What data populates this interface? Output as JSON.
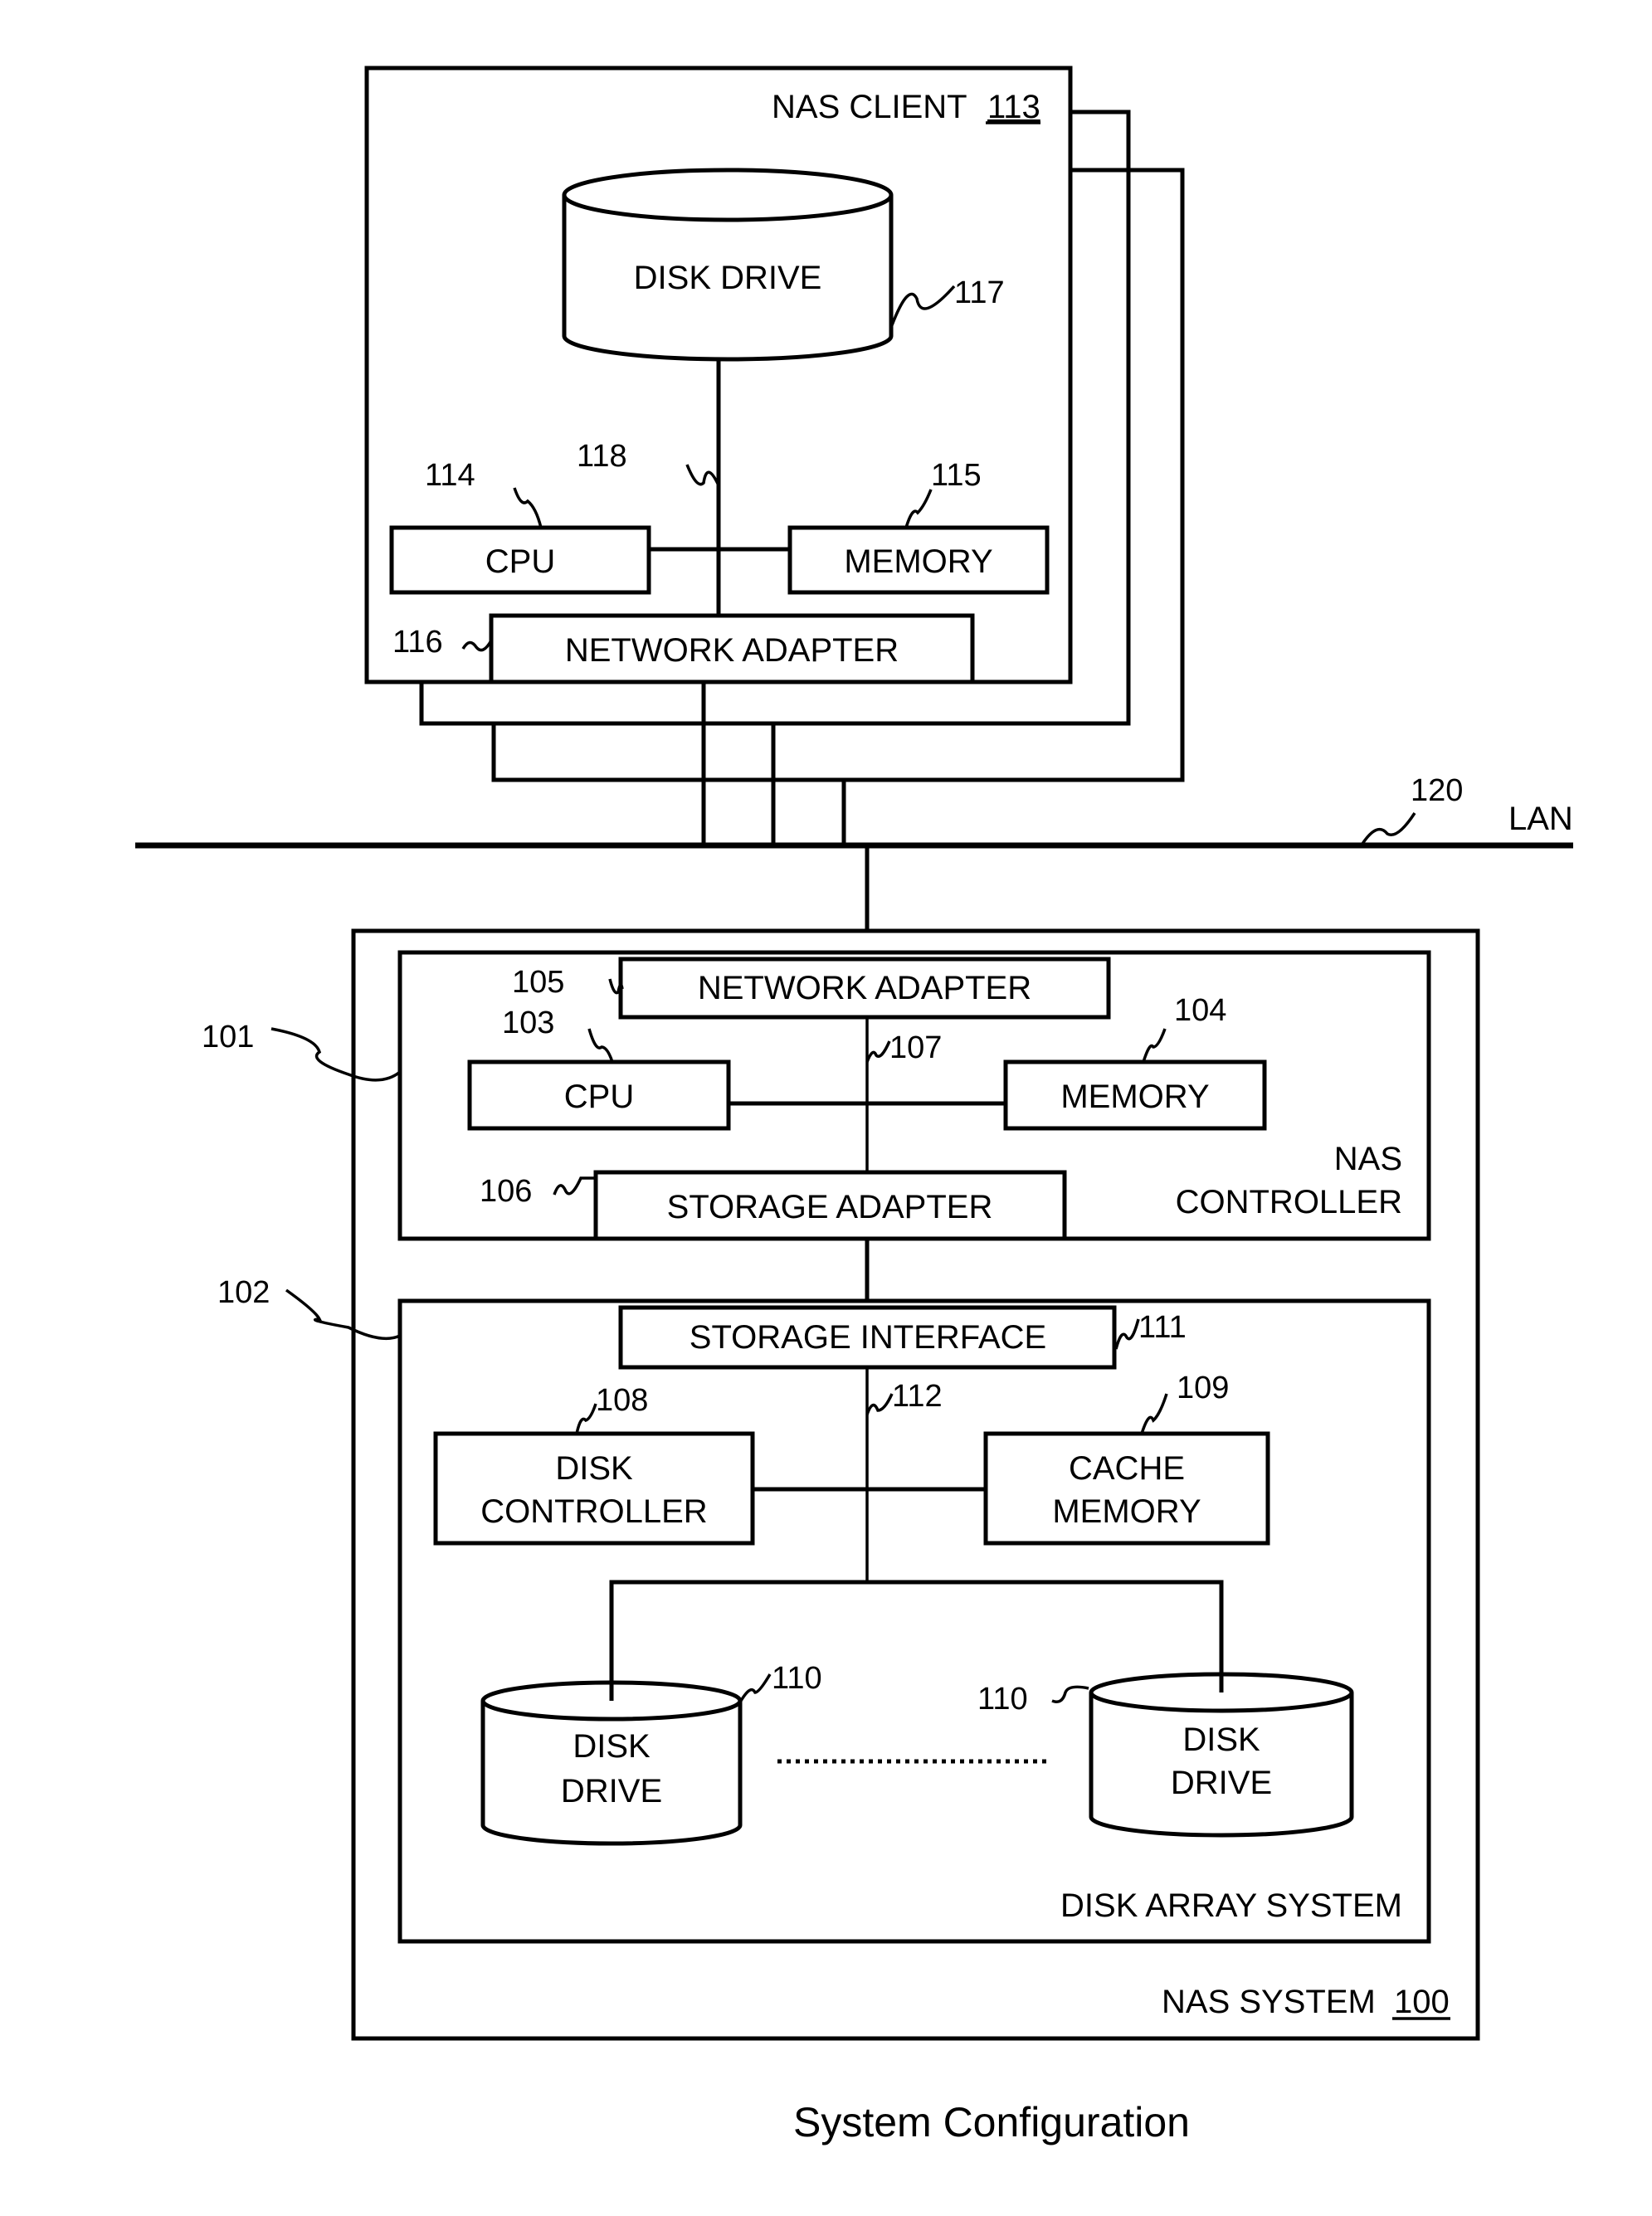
{
  "caption": "System Configuration",
  "lan": {
    "label": "LAN",
    "ref": "120"
  },
  "nas_client": {
    "title": "NAS CLIENT",
    "ref": "113",
    "disk_drive": {
      "label": "DISK DRIVE",
      "ref": "117"
    },
    "bus_ref": "118",
    "cpu": {
      "label": "CPU",
      "ref": "114"
    },
    "memory": {
      "label": "MEMORY",
      "ref": "115"
    },
    "network_adapter": {
      "label": "NETWORK ADAPTER",
      "ref": "116"
    }
  },
  "nas_system": {
    "title": "NAS SYSTEM",
    "ref": "100",
    "nas_controller": {
      "title_line1": "NAS",
      "title_line2": "CONTROLLER",
      "ref": "101",
      "network_adapter": {
        "label": "NETWORK ADAPTER",
        "ref": "105"
      },
      "cpu": {
        "label": "CPU",
        "ref": "103"
      },
      "memory": {
        "label": "MEMORY",
        "ref": "104"
      },
      "bus_ref": "107",
      "storage_adapter": {
        "label": "STORAGE ADAPTER",
        "ref": "106"
      }
    },
    "disk_array": {
      "title": "DISK ARRAY SYSTEM",
      "ref": "102",
      "storage_interface": {
        "label": "STORAGE INTERFACE",
        "ref": "111"
      },
      "bus_ref": "112",
      "disk_controller": {
        "line1": "DISK",
        "line2": "CONTROLLER",
        "ref": "108"
      },
      "cache_memory": {
        "line1": "CACHE",
        "line2": "MEMORY",
        "ref": "109"
      },
      "disk_drives": [
        {
          "line1": "DISK",
          "line2": "DRIVE",
          "ref": "110"
        },
        {
          "line1": "DISK",
          "line2": "DRIVE",
          "ref": "110"
        }
      ]
    }
  }
}
